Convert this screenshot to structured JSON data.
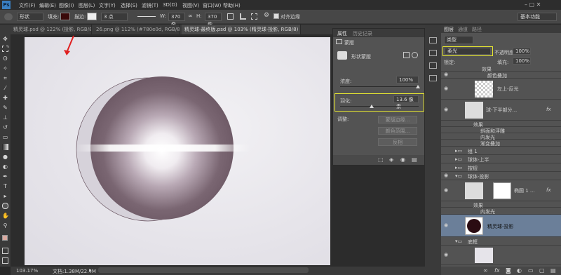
{
  "menu": {
    "logo": "Ps",
    "items": [
      "文件(F)",
      "编辑(E)",
      "图像(I)",
      "图层(L)",
      "文字(Y)",
      "选择(S)",
      "滤镜(T)",
      "3D(D)",
      "视图(V)",
      "窗口(W)",
      "帮助(H)"
    ]
  },
  "options": {
    "mode": "形状",
    "fill_label": "填充:",
    "stroke_label": "描边:",
    "stroke_size": "3 点",
    "w_label": "W:",
    "w_value": "370 像",
    "h_label": "H:",
    "h_value": "370 像",
    "align_edges": "对齐边缘",
    "workspace": "基本功能"
  },
  "tabs": [
    "精灵球.psd @ 122% (投影, RGB/8) *",
    "26.png @ 112% (#780e0d, RGB/8#) *",
    "精灵球-最终版.psd @ 103% (精灵球-投影, RGB/8)"
  ],
  "status": {
    "zoom": "103.17%",
    "doc": "文档:1.38M/22.4M"
  },
  "properties": {
    "tab1": "属性",
    "tab2": "历史记录",
    "section": "蒙版",
    "mask_type": "形状蒙版",
    "density_label": "浓度:",
    "density_value": "100%",
    "feather_label": "羽化:",
    "feather_value": "13.6 像素",
    "adjust_label": "调整:",
    "btn_mask_edge": "蒙版边缘...",
    "btn_color_range": "颜色范围...",
    "btn_invert": "反相"
  },
  "layers": {
    "tabs": [
      "图层",
      "通道",
      "路径"
    ],
    "filter": "类型",
    "blend": "柔光",
    "opacity_label": "不透明度:",
    "opacity": "100%",
    "lock_label": "锁定:",
    "fill_label": "填充:",
    "fill": "100%",
    "rows": [
      {
        "name": "效果"
      },
      {
        "name": "颜色叠加"
      },
      {
        "name": "左上-反光"
      },
      {
        "name": "球-下半部分..."
      },
      {
        "name": "效果"
      },
      {
        "name": "斜面和浮雕"
      },
      {
        "name": "内发光"
      },
      {
        "name": "渐变叠加"
      },
      {
        "name": "组 1"
      },
      {
        "name": "球体-上半"
      },
      {
        "name": "按钮"
      },
      {
        "name": "球体-投影"
      },
      {
        "name": "椭圆 1 ..."
      },
      {
        "name": "效果"
      },
      {
        "name": "内发光"
      },
      {
        "name": "精灵球-投影"
      },
      {
        "name": "底框"
      }
    ]
  },
  "colors": {
    "highlight": "#e8e830",
    "selected_layer": "#6b7f99",
    "ball": "#6e5a66",
    "arrow": "#e02020"
  }
}
